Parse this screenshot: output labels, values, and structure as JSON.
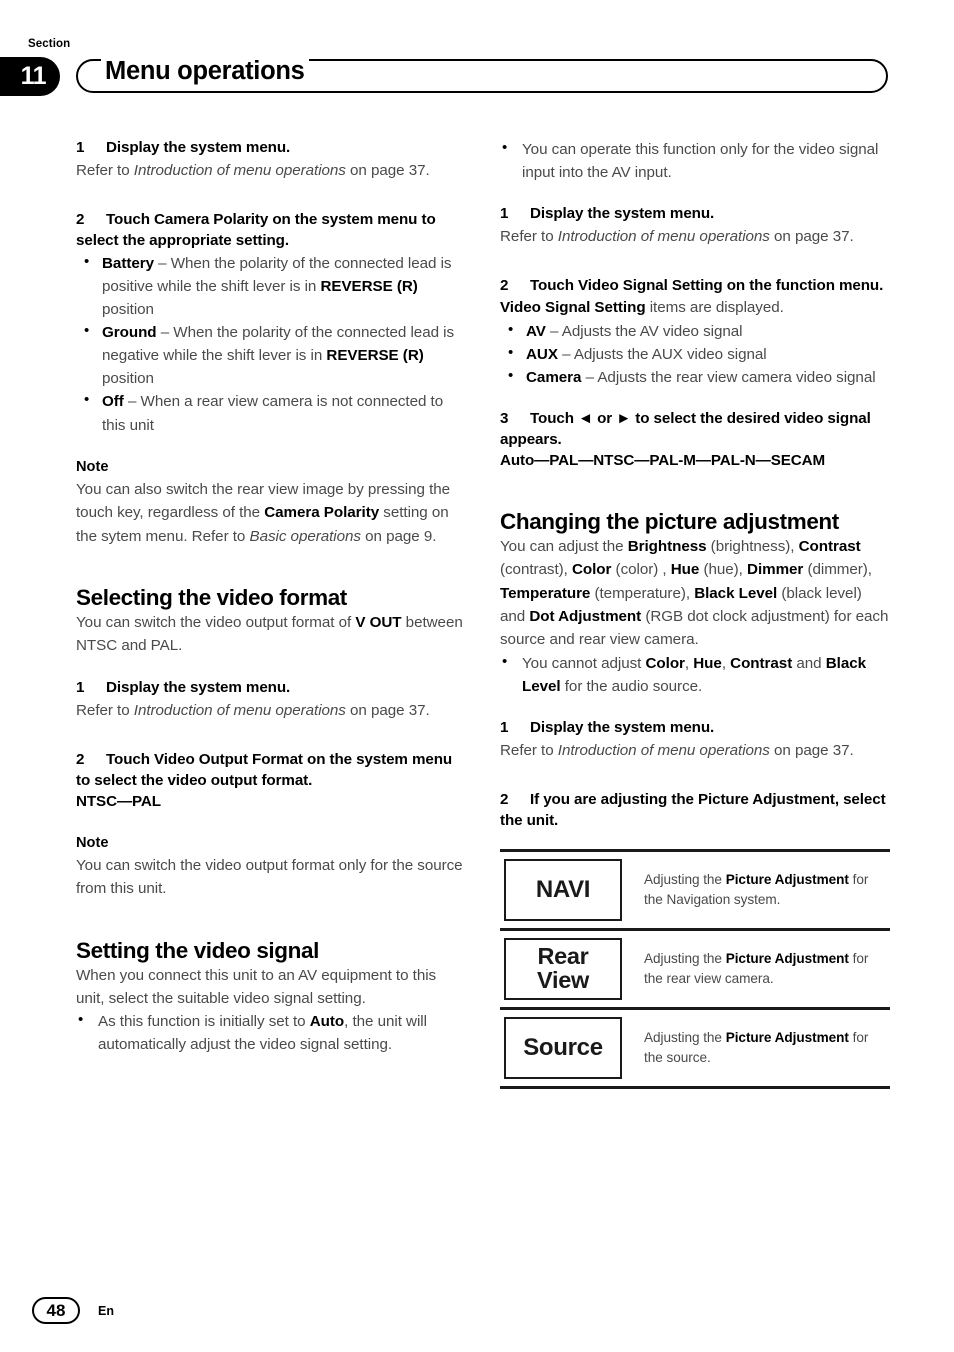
{
  "header": {
    "section_label": "Section",
    "section_number": "11",
    "title": "Menu operations"
  },
  "footer": {
    "page_number": "48",
    "language": "En"
  },
  "left_column": {
    "step1": {
      "num": "1",
      "text": "Display the system menu."
    },
    "step1_refer": "Refer to Introduction of menu operations on page 37.",
    "step1_refer_parts": {
      "pre": "Refer to ",
      "italic": "Introduction of menu operations",
      "post": " on page 37."
    },
    "step2": {
      "num": "2",
      "text": "Touch Camera Polarity on the system menu to select the appropriate setting."
    },
    "polarity_options": [
      {
        "term": "Battery",
        "dash": " – ",
        "desc_pre": "When the polarity of the connected lead is positive while the shift lever is in ",
        "desc_bold": "REVERSE (R)",
        "desc_post": " position"
      },
      {
        "term": "Ground",
        "dash": " – ",
        "desc_pre": "When the polarity of the connected lead is negative while the shift lever is in ",
        "desc_bold": "REVERSE (R)",
        "desc_post": " position"
      },
      {
        "term": "Off",
        "dash": " – ",
        "desc_pre": "When a rear view camera is not connected to this unit",
        "desc_bold": "",
        "desc_post": ""
      }
    ],
    "note1_heading": "Note",
    "note1_pre": "You can also switch the rear view image by pressing the touch key, regardless of the ",
    "note1_bold": "Camera Polarity",
    "note1_mid": " setting on the sytem menu. Refer to ",
    "note1_italic": "Basic operations",
    "note1_post": " on page 9.",
    "heading_video_format": "Selecting the video format",
    "video_format_intro_pre": "You can switch the video output format of ",
    "video_format_intro_bold": "V OUT",
    "video_format_intro_post": " between NTSC and PAL.",
    "vf_step1": {
      "num": "1",
      "text": "Display the system menu."
    },
    "vf_step2": {
      "num": "2",
      "text": "Touch Video Output Format on the system menu to select the video output format."
    },
    "vf_values": "NTSC—PAL",
    "note2_heading": "Note",
    "note2_text": "You can switch the video output format only for the source from this unit.",
    "heading_video_signal": "Setting the video signal",
    "video_signal_intro": "When you connect this unit to an AV equipment to this unit, select the suitable video signal setting.",
    "video_signal_bullet_pre": "As this function is initially set to ",
    "video_signal_bullet_bold": "Auto",
    "video_signal_bullet_post": ", the unit will automatically adjust the video signal setting."
  },
  "right_column": {
    "top_bullet": "You can operate this function only for the video signal input into the AV input.",
    "vs_step1": {
      "num": "1",
      "text": "Display the system menu."
    },
    "vs_step2": {
      "num": "2",
      "text": "Touch Video Signal Setting on the function menu."
    },
    "vs_items_line_bold": "Video Signal Setting",
    "vs_items_line_rest": " items are displayed.",
    "vs_items": [
      {
        "term": "AV",
        "dash": " – ",
        "desc": "Adjusts the AV video signal"
      },
      {
        "term": "AUX",
        "dash": " – ",
        "desc": "Adjusts the AUX video signal"
      },
      {
        "term": "Camera",
        "dash": " – ",
        "desc": "Adjusts the rear view camera video signal"
      }
    ],
    "vs_step3": {
      "num": "3",
      "text": "Touch ◄ or ► to select the desired video signal appears."
    },
    "vs_step3_values": "Auto—PAL—NTSC—PAL-M—PAL-N—SECAM",
    "heading_picture": "Changing the picture adjustment",
    "picture_intro": {
      "p1": "You can adjust the ",
      "b1": "Brightness",
      "p2": " (brightness), ",
      "b2": "Contrast",
      "p3": " (contrast), ",
      "b3": "Color",
      "p4": " (color) , ",
      "b4": "Hue",
      "p5": " (hue), ",
      "b5": "Dimmer",
      "p6": " (dimmer), ",
      "b6": "Temperature",
      "p7": " (temperature), ",
      "b7": "Black Level",
      "p8": " (black level) and ",
      "b8": "Dot Adjustment",
      "p9": " (RGB dot clock adjustment) for each source and rear view camera."
    },
    "picture_bullet": {
      "p1": "You cannot adjust ",
      "b1": "Color",
      "p2": ", ",
      "b2": "Hue",
      "p3": ", ",
      "b3": "Contrast",
      "p4": " and ",
      "b4": "Black Level",
      "p5": " for the audio source."
    },
    "pa_step1": {
      "num": "1",
      "text": "Display the system menu."
    },
    "pa_step2": {
      "num": "2",
      "text": "If you are adjusting the Picture Adjustment, select the unit."
    },
    "unit_table": [
      {
        "key": "NAVI",
        "desc_pre": "Adjusting the ",
        "desc_bold": "Picture Adjustment",
        "desc_post": " for the Navigation system."
      },
      {
        "key": "Rear\nView",
        "key_line1": "Rear",
        "key_line2": "View",
        "desc_pre": "Adjusting the ",
        "desc_bold": "Picture Adjustment",
        "desc_post": " for the rear view camera."
      },
      {
        "key": "Source",
        "desc_pre": "Adjusting the ",
        "desc_bold": "Picture Adjustment",
        "desc_post": " for the source."
      }
    ]
  },
  "colors": {
    "ink": "#1a1a1a",
    "body_text": "#4a4a4a",
    "background": "#ffffff"
  }
}
